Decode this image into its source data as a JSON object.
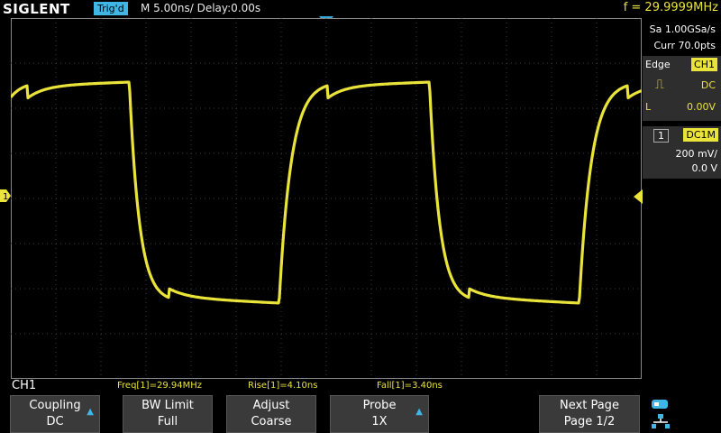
{
  "brand": "SIGLENT",
  "header": {
    "trigger_status": "Trig'd",
    "timebase": "M 5.00ns/  Delay:0.00s",
    "frequency": "f = 29.9999MHz"
  },
  "acquisition": {
    "sample_rate": "Sa 1.00GSa/s",
    "points": "Curr 70.0pts"
  },
  "trigger_panel": {
    "type": "Edge",
    "source": "CH1",
    "coupling": "DC",
    "level_label": "L",
    "level": "0.00V"
  },
  "channel_panel": {
    "number": "1",
    "coupling": "DC1M",
    "scale": "200 mV/",
    "offset": "0.0 V"
  },
  "markers": {
    "left_channel": "1"
  },
  "measurements": {
    "channel": "CH1",
    "items": [
      "Freq[1]=29.94MHz",
      "Rise[1]=4.10ns",
      "Fall[1]=3.40ns"
    ]
  },
  "softkeys": [
    {
      "line1": "Coupling",
      "line2": "DC",
      "has_arrow": true
    },
    {
      "line1": "BW Limit",
      "line2": "Full",
      "has_arrow": false
    },
    {
      "line1": "Adjust",
      "line2": "Coarse",
      "has_arrow": false
    },
    {
      "line1": "Probe",
      "line2": "1X",
      "has_arrow": true
    },
    {
      "line1": "Next Page",
      "line2": "Page 1/2",
      "has_arrow": false
    }
  ],
  "colors": {
    "trace": "#e9e33a",
    "grid": "#3a3a3a",
    "accent": "#3fb6e6",
    "panel": "#2e2e2e"
  },
  "waveform": {
    "type": "square",
    "period_ns": 33.3,
    "high_level_div": 2.5,
    "low_level_div": -2.2,
    "rise_time_ns": 4.1,
    "fall_time_ns": 3.4
  },
  "icons": {
    "arrow": "up-arrow-icon",
    "usb": "usb-icon",
    "network": "network-icon"
  }
}
